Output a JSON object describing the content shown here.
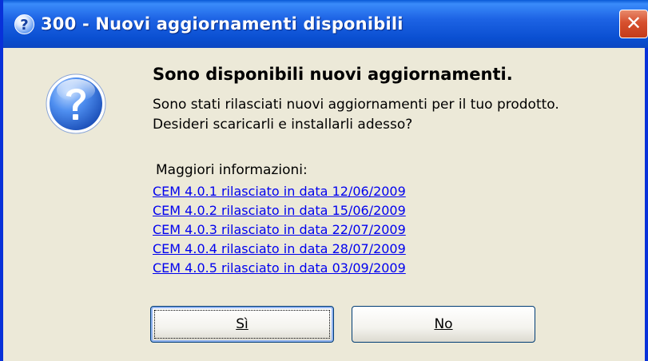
{
  "window": {
    "title": "300 - Nuovi aggiornamenti disponibili",
    "help_glyph": "?",
    "close_glyph": "✕",
    "title_icon": "help-icon",
    "close_icon": "close-icon"
  },
  "dialog": {
    "icon": "question-icon",
    "heading": "Sono disponibili nuovi aggiornamenti.",
    "message_line1": "Sono stati rilasciati nuovi aggiornamenti per il tuo prodotto.",
    "message_line2": "Desideri scaricarli e installarli adesso?",
    "more_info_label": "Maggiori informazioni:",
    "links": [
      "CEM 4.0.1 rilasciato in data 12/06/2009",
      "CEM 4.0.2 rilasciato in data 15/06/2009",
      "CEM 4.0.3 rilasciato in data 22/07/2009",
      "CEM 4.0.4 rilasciato in data 28/07/2009",
      "CEM 4.0.5 rilasciato in data 03/09/2009"
    ]
  },
  "buttons": {
    "yes_label": "Sì",
    "no_label": "No"
  },
  "colors": {
    "titlebar": "#0a4fd1",
    "close_button": "#d6502e",
    "link": "#0000ee",
    "dialog_bg": "#ece9d8"
  }
}
